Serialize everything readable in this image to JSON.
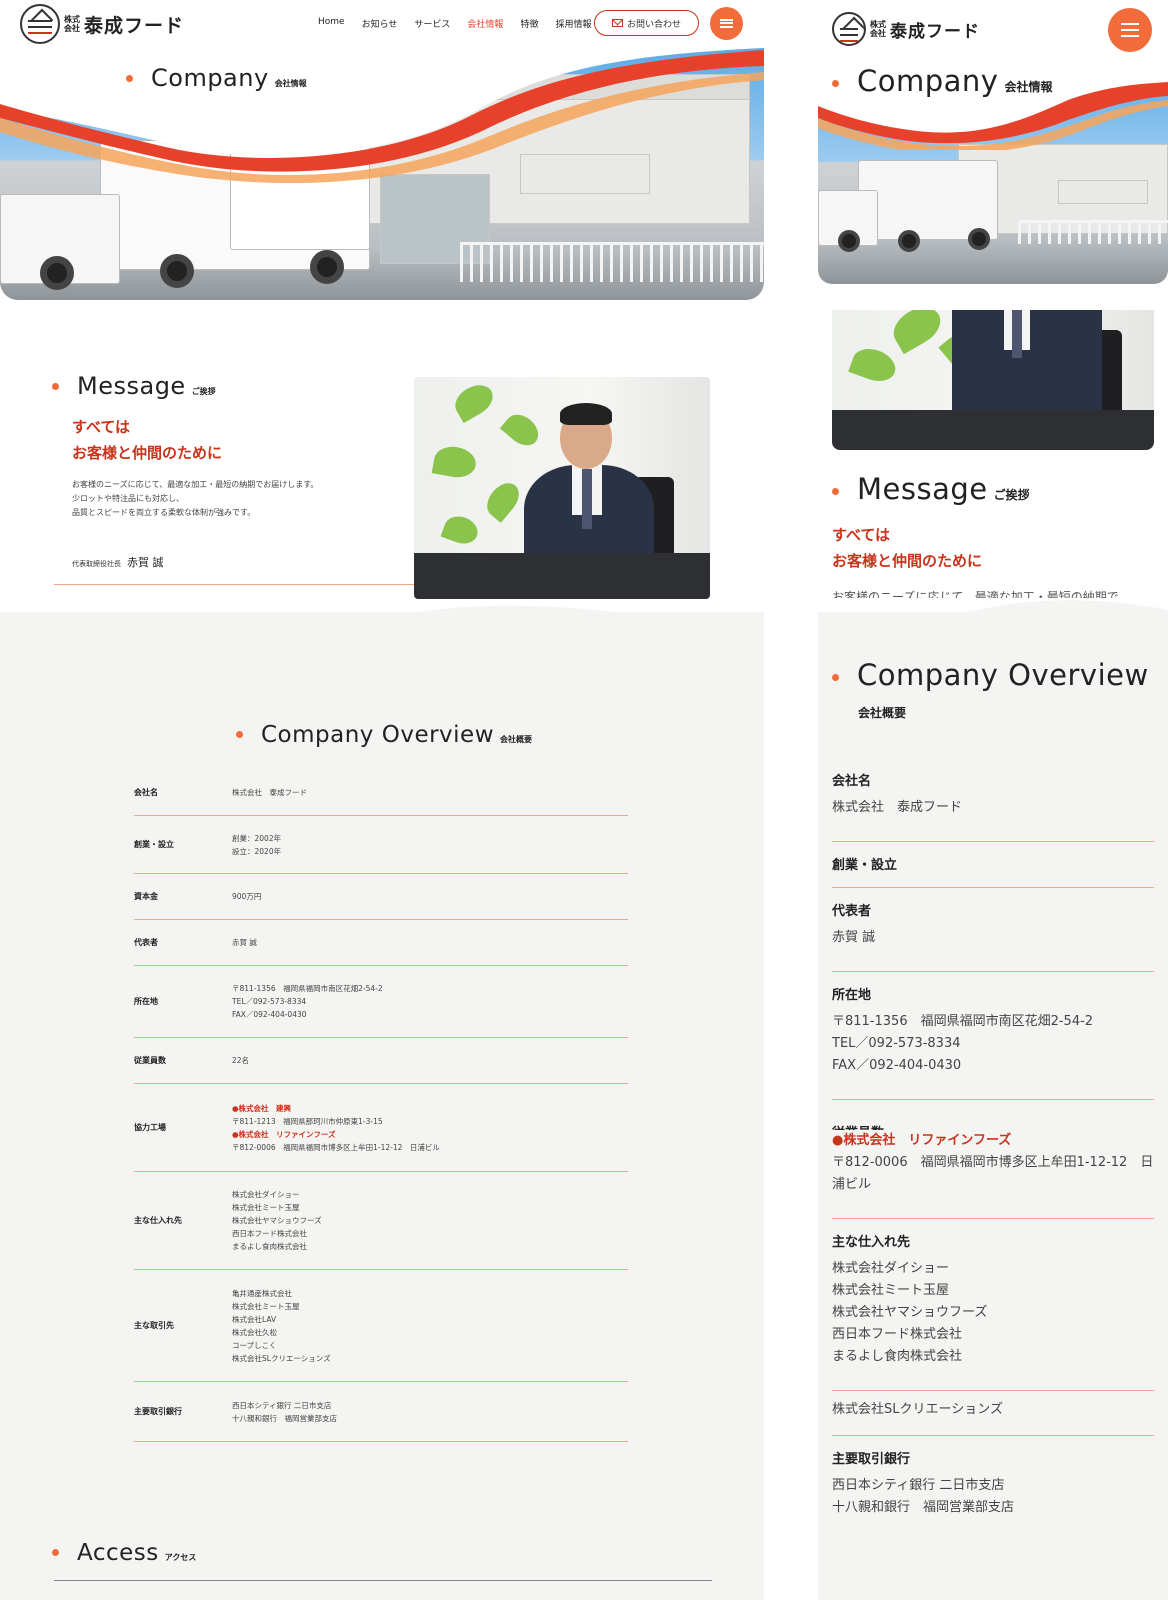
{
  "brand": {
    "logo_small": "株式会社",
    "logo_name": "泰成フード",
    "accent": "#e8412b",
    "orange": "#f26b3a"
  },
  "nav": {
    "items": [
      "Home",
      "お知らせ",
      "サービス",
      "会社情報",
      "特徴",
      "採用情報"
    ],
    "active_index": 3,
    "contact_label": "お問い合わせ"
  },
  "hero": {
    "title_en": "Company",
    "title_jp": "会社情報"
  },
  "message": {
    "title_en": "Message",
    "title_jp": "ご挨拶",
    "catch_1": "すべては",
    "catch_2": "お客様と仲間のために",
    "body": [
      "お客様のニーズに応じて、最適な加工・最短の納期でお届けします。",
      "少ロットや特注品にも対応し、",
      "品質とスピードを両立する柔軟な体制が強みです。"
    ],
    "mobile_body_cut": "お客様のニーズに応じて、最適な加工・最短の納期で",
    "sign_role": "代表取締役社長",
    "sign_name": "赤賀 誠"
  },
  "overview": {
    "title_en": "Company Overview",
    "title_jp": "会社概要",
    "rows": [
      {
        "th": "会社名",
        "td": [
          "株式会社　泰成フード"
        ]
      },
      {
        "th": "創業・設立",
        "td": [
          "創業：2002年",
          "設立：2020年"
        ]
      },
      {
        "th": "資本金",
        "td": [
          "900万円"
        ]
      },
      {
        "th": "代表者",
        "td": [
          "赤賀 誠"
        ]
      },
      {
        "th": "所在地",
        "td": [
          "〒811-1356　福岡県福岡市南区花畑2-54-2",
          "TEL／092-573-8334",
          "FAX／092-404-0430"
        ]
      },
      {
        "th": "従業員数",
        "td": [
          "22名"
        ]
      },
      {
        "th": "協力工場",
        "td": [
          "●株式会社　建興",
          "〒811-1213　福岡県那珂川市仲原東1-3-15",
          "●株式会社　リファインフーズ",
          "〒812-0006　福岡県福岡市博多区上牟田1-12-12　日浦ビル"
        ]
      },
      {
        "th": "主な仕入れ先",
        "td": [
          "株式会社ダイショー",
          "株式会社ミート玉屋",
          "株式会社ヤマショウフーズ",
          "西日本フード株式会社",
          "まるよし食肉株式会社"
        ]
      },
      {
        "th": "主な取引先",
        "td": [
          "亀井通産株式会社",
          "株式会社ミート玉屋",
          "株式会社LAV",
          "株式会社久松",
          "コープしこく",
          "株式会社SLクリエーションズ"
        ]
      },
      {
        "th": "主要取引銀行",
        "td": [
          "西日本シティ銀行 二日市支店",
          "十八親和銀行　福岡営業部支店"
        ]
      }
    ]
  },
  "mobile_overview": {
    "rows": [
      {
        "th": "会社名",
        "td": [
          "株式会社　泰成フード"
        ]
      },
      {
        "th": "創業・設立",
        "td": []
      },
      {
        "th": "代表者",
        "td": [
          "赤賀 誠"
        ]
      },
      {
        "th": "所在地",
        "td": [
          "〒811-1356　福岡県福岡市南区花畑2-54-2",
          "TEL／092-573-8334",
          "FAX／092-404-0430"
        ]
      },
      {
        "th": "従業員数",
        "td": [
          "●株式会社　リファインフーズ",
          "〒812-0006　福岡県福岡市博多区上牟田1-12-12　日",
          "浦ビル"
        ]
      },
      {
        "th": "主な仕入れ先",
        "td": [
          "株式会社ダイショー",
          "株式会社ミート玉屋",
          "株式会社ヤマショウフーズ",
          "西日本フード株式会社",
          "まるよし食肉株式会社"
        ]
      },
      {
        "th": "",
        "td": [
          "株式会社SLクリエーションズ"
        ]
      },
      {
        "th": "主要取引銀行",
        "td": [
          "西日本シティ銀行 二日市支店",
          "十八親和銀行　福岡営業部支店"
        ]
      }
    ]
  },
  "access": {
    "title_en": "Access",
    "title_jp": "アクセス"
  }
}
